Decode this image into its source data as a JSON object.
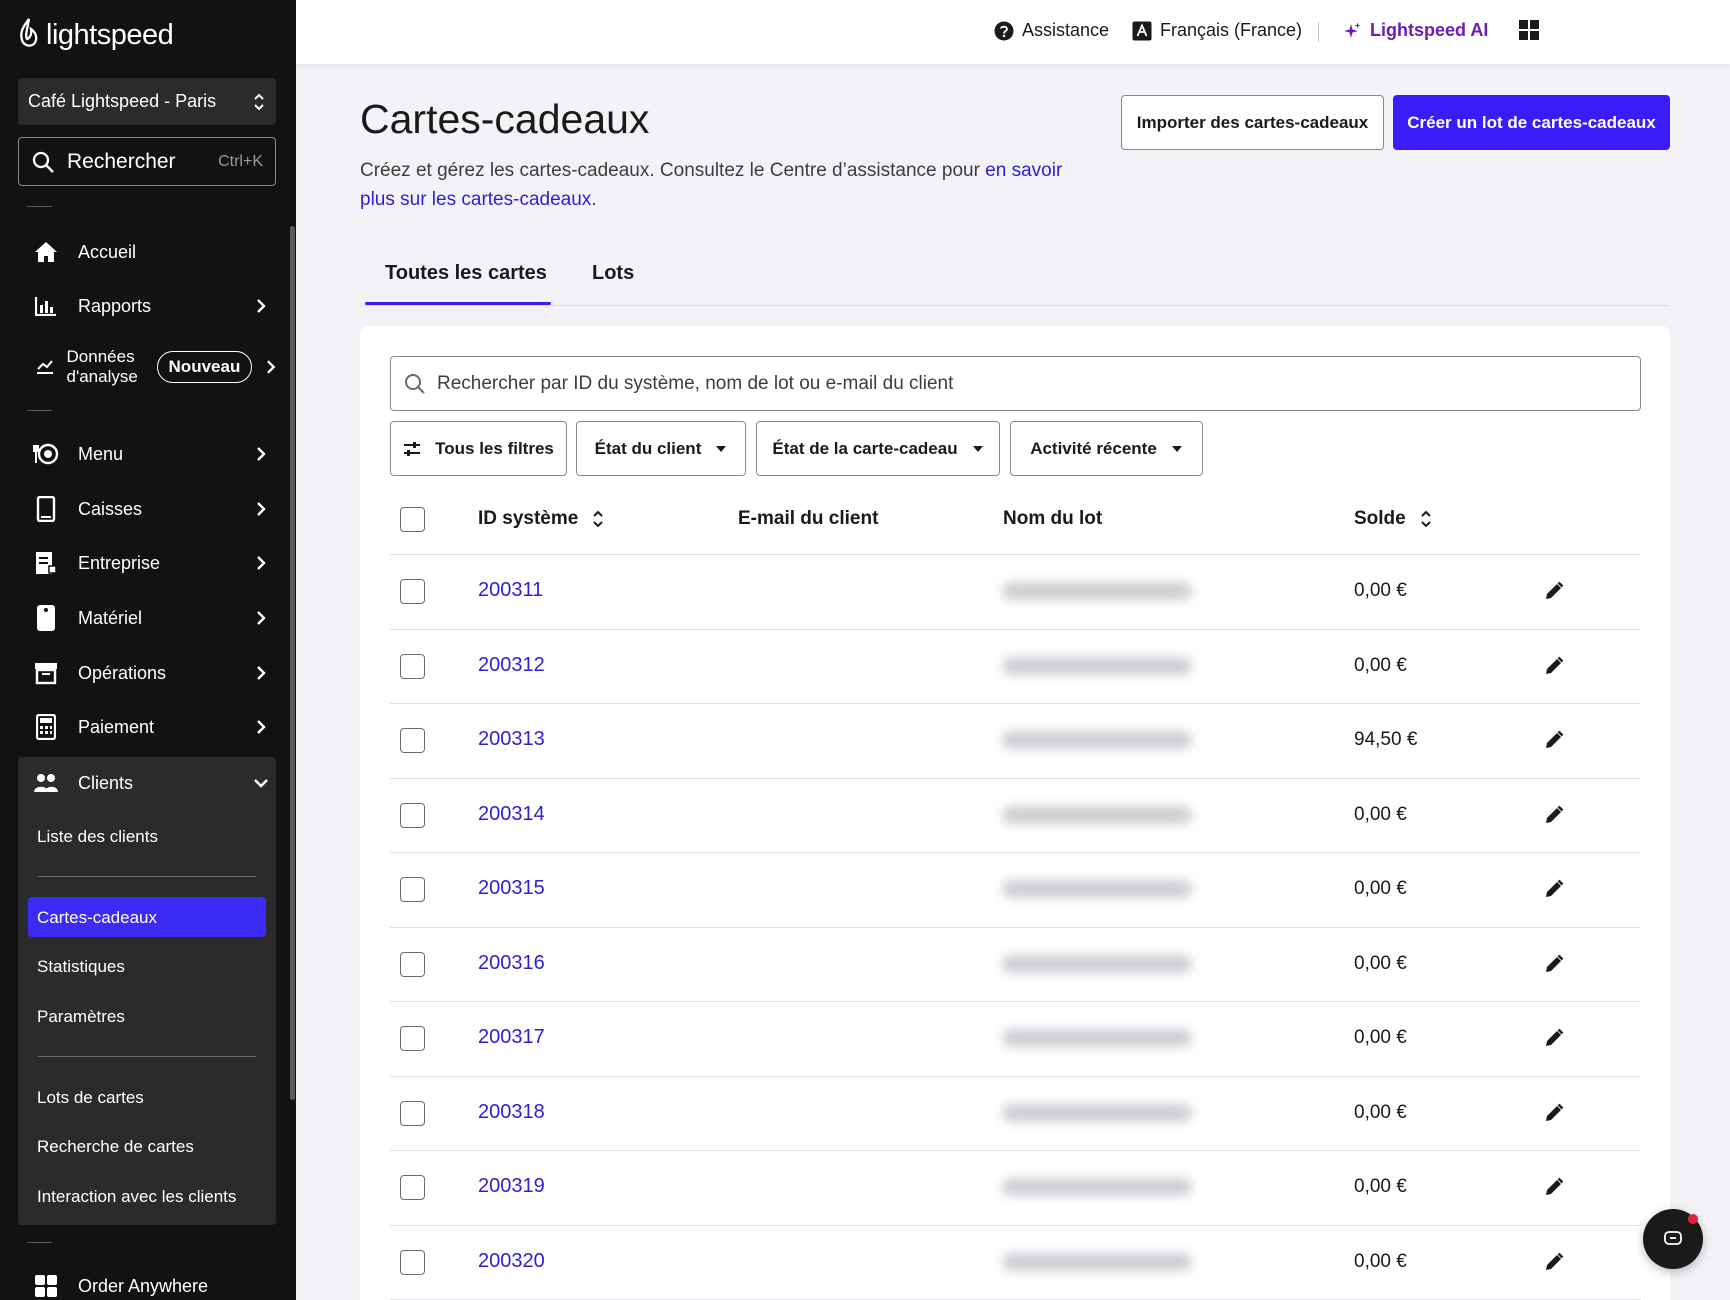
{
  "brand": {
    "name": "lightspeed",
    "accent": "#3b1cf6",
    "link": "#2d1fd6"
  },
  "sidebar": {
    "store": "Café Lightspeed - Paris",
    "search_label": "Rechercher",
    "search_shortcut": "Ctrl+K",
    "items": [
      {
        "label": "Accueil",
        "icon": "home-icon"
      },
      {
        "label": "Rapports",
        "icon": "bar-chart-icon"
      },
      {
        "label": "Données d'analyse",
        "icon": "trend-icon",
        "badge": "Nouveau"
      },
      {
        "label": "Menu",
        "icon": "menu-icon"
      },
      {
        "label": "Caisses",
        "icon": "tablet-icon"
      },
      {
        "label": "Entreprise",
        "icon": "document-icon"
      },
      {
        "label": "Matériel",
        "icon": "device-icon"
      },
      {
        "label": "Opérations",
        "icon": "archive-icon"
      },
      {
        "label": "Paiement",
        "icon": "calculator-icon"
      },
      {
        "label": "Clients",
        "icon": "users-icon"
      }
    ],
    "clients_sub": {
      "list": "Liste des clients",
      "gift_cards": "Cartes-cadeaux",
      "stats": "Statistiques",
      "settings": "Paramètres",
      "card_lots": "Lots de cartes",
      "card_search": "Recherche de cartes",
      "interaction": "Interaction avec les clients"
    },
    "order_anywhere": "Order Anywhere"
  },
  "topbar": {
    "assistance": "Assistance",
    "language": "Français (France)",
    "ai": "Lightspeed AI"
  },
  "page": {
    "title": "Cartes-cadeaux",
    "description": "Créez et gérez les cartes-cadeaux. Consultez le Centre d’assistance pour ",
    "description_link": "en savoir plus sur les cartes-cadeaux",
    "description_end": ".",
    "import_button": "Importer des cartes-cadeaux",
    "create_button": "Créer un lot de cartes-cadeaux"
  },
  "tabs": [
    "Toutes les cartes",
    "Lots"
  ],
  "table": {
    "search_placeholder": "Rechercher par ID du système, nom de lot ou e-mail du client",
    "filters": [
      "Tous les filtres",
      "État du client",
      "État de la carte-cadeau",
      "Activité récente"
    ],
    "columns": [
      "ID système",
      "E-mail du client",
      "Nom du lot",
      "Solde"
    ],
    "rows": [
      {
        "id": "200311",
        "balance": "0,00 €"
      },
      {
        "id": "200312",
        "balance": "0,00 €"
      },
      {
        "id": "200313",
        "balance": "94,50 €"
      },
      {
        "id": "200314",
        "balance": "0,00 €"
      },
      {
        "id": "200315",
        "balance": "0,00 €"
      },
      {
        "id": "200316",
        "balance": "0,00 €"
      },
      {
        "id": "200317",
        "balance": "0,00 €"
      },
      {
        "id": "200318",
        "balance": "0,00 €"
      },
      {
        "id": "200319",
        "balance": "0,00 €"
      },
      {
        "id": "200320",
        "balance": "0,00 €"
      }
    ]
  }
}
